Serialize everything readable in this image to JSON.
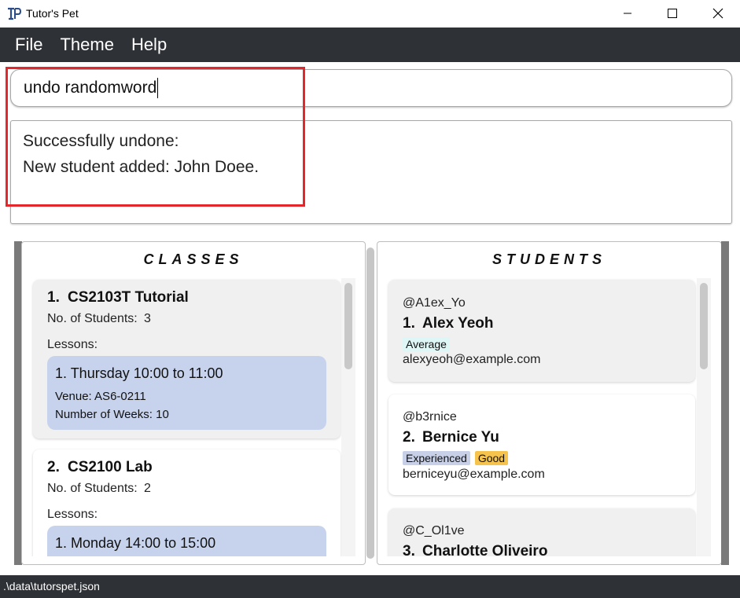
{
  "window": {
    "title": "Tutor's Pet",
    "app_icon_text": "TP"
  },
  "menu": {
    "items": [
      "File",
      "Theme",
      "Help"
    ]
  },
  "command_box": {
    "value": "undo randomword"
  },
  "result_box": {
    "lines": [
      "Successfully undone:",
      "New student added: John Doee."
    ]
  },
  "classes_panel": {
    "heading": "CLASSES",
    "classes": [
      {
        "index": "1.",
        "name": "CS2103T Tutorial",
        "students_label": "No. of Students:",
        "students_count": "3",
        "lessons_label": "Lessons:",
        "lessons": [
          {
            "title": "1. Thursday 10:00 to 11:00",
            "venue": "Venue: AS6-0211",
            "weeks": "Number of Weeks: 10"
          }
        ]
      },
      {
        "index": "2.",
        "name": "CS2100 Lab",
        "students_label": "No. of Students:",
        "students_count": "2",
        "lessons_label": "Lessons:",
        "lessons": [
          {
            "title": "1. Monday 14:00 to 15:00"
          }
        ]
      }
    ]
  },
  "students_panel": {
    "heading": "STUDENTS",
    "students": [
      {
        "handle": "@A1ex_Yo",
        "index": "1.",
        "name": "Alex Yeoh",
        "tags": [
          {
            "label": "Average",
            "color": "#dff6f6"
          }
        ],
        "email": "alexyeoh@example.com"
      },
      {
        "handle": "@b3rnice",
        "index": "2.",
        "name": "Bernice Yu",
        "tags": [
          {
            "label": "Experienced",
            "color": "#c7d0e6"
          },
          {
            "label": "Good",
            "color": "#f6c44d"
          }
        ],
        "email": "berniceyu@example.com"
      },
      {
        "handle": "@C_Ol1ve",
        "index": "3.",
        "name": "Charlotte Oliveiro"
      }
    ]
  },
  "status_bar": {
    "path": ".\\data\\tutorspet.json"
  },
  "colors": {
    "menubar_bg": "#2e3136",
    "highlight": "#e5262a",
    "lesson_bg": "#c7d3ed"
  }
}
